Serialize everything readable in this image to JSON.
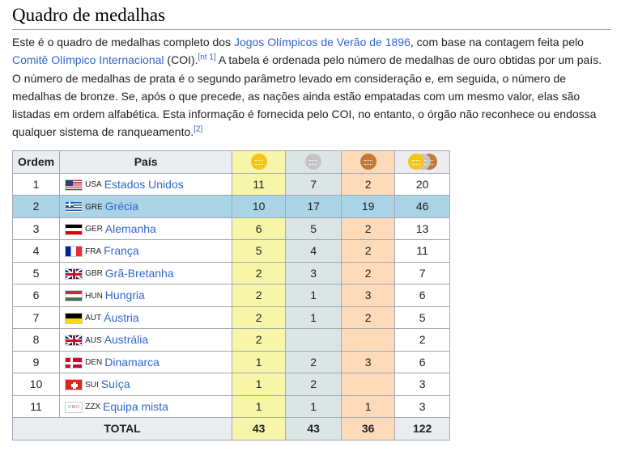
{
  "section": {
    "title": "Quadro de medalhas"
  },
  "intro": {
    "p1": "Este é o quadro de medalhas completo dos ",
    "link_games": "Jogos Olímpicos de Verão de 1896",
    "p2": ", com base na contagem feita pelo ",
    "link_ioc": "Comitê Olímpico Internacional",
    "p3": " (COI).",
    "note_ref": "[nt 1]",
    "p4": " A tabela é ordenada pelo número de medalhas de ouro obtidas por um país. O número de medalhas de prata é o segundo parâmetro levado em consideração e, em seguida, o número de medalhas de bronze. Se, após o que precede, as nações ainda estão empatadas com um mesmo valor, elas são listadas em ordem alfabética. Esta informação é fornecida pelo COI, no entanto, o órgão não reconhece ou endossa qualquer sistema de ranqueamento.",
    "ref": "[2]"
  },
  "table": {
    "headers": {
      "rank": "Ordem",
      "nation": "País"
    },
    "medal_icons": {
      "gold": "gold-medal-icon",
      "silver": "silver-medal-icon",
      "bronze": "bronze-medal-icon",
      "total": "total-medals-icon"
    },
    "colors": {
      "gold": "#f7f6a8",
      "silver": "#dce5e5",
      "bronze": "#ffdab9",
      "host": "#aad4e6"
    },
    "rows": [
      {
        "rank": "1",
        "code": "USA",
        "country": "Estados Unidos",
        "gold": "11",
        "silver": "7",
        "bronze": "2",
        "total": "20",
        "flag": "usa-flag-icon"
      },
      {
        "rank": "2",
        "code": "GRE",
        "country": "Grécia",
        "gold": "10",
        "silver": "17",
        "bronze": "19",
        "total": "46",
        "flag": "greece-flag-icon"
      },
      {
        "rank": "3",
        "code": "GER",
        "country": "Alemanha",
        "gold": "6",
        "silver": "5",
        "bronze": "2",
        "total": "13",
        "flag": "germany-flag-icon"
      },
      {
        "rank": "4",
        "code": "FRA",
        "country": "França",
        "gold": "5",
        "silver": "4",
        "bronze": "2",
        "total": "11",
        "flag": "france-flag-icon"
      },
      {
        "rank": "5",
        "code": "GBR",
        "country": "Grã-Bretanha",
        "gold": "2",
        "silver": "3",
        "bronze": "2",
        "total": "7",
        "flag": "great-britain-flag-icon"
      },
      {
        "rank": "6",
        "code": "HUN",
        "country": "Hungria",
        "gold": "2",
        "silver": "1",
        "bronze": "3",
        "total": "6",
        "flag": "hungary-flag-icon"
      },
      {
        "rank": "7",
        "code": "AUT",
        "country": "Áustria",
        "gold": "2",
        "silver": "1",
        "bronze": "2",
        "total": "5",
        "flag": "austria-flag-icon"
      },
      {
        "rank": "8",
        "code": "AUS",
        "country": "Austrália",
        "gold": "2",
        "silver": "",
        "bronze": "",
        "total": "2",
        "flag": "australia-flag-icon"
      },
      {
        "rank": "9",
        "code": "DEN",
        "country": "Dinamarca",
        "gold": "1",
        "silver": "2",
        "bronze": "3",
        "total": "6",
        "flag": "denmark-flag-icon"
      },
      {
        "rank": "10",
        "code": "SUI",
        "country": "Suíça",
        "gold": "1",
        "silver": "2",
        "bronze": "",
        "total": "3",
        "flag": "switzerland-flag-icon"
      },
      {
        "rank": "11",
        "code": "ZZX",
        "country": "Equipa mista",
        "gold": "1",
        "silver": "1",
        "bronze": "1",
        "total": "3",
        "flag": "olympic-flag-icon"
      }
    ],
    "totals": {
      "label": "TOTAL",
      "gold": "43",
      "silver": "43",
      "bronze": "36",
      "total": "122"
    }
  }
}
